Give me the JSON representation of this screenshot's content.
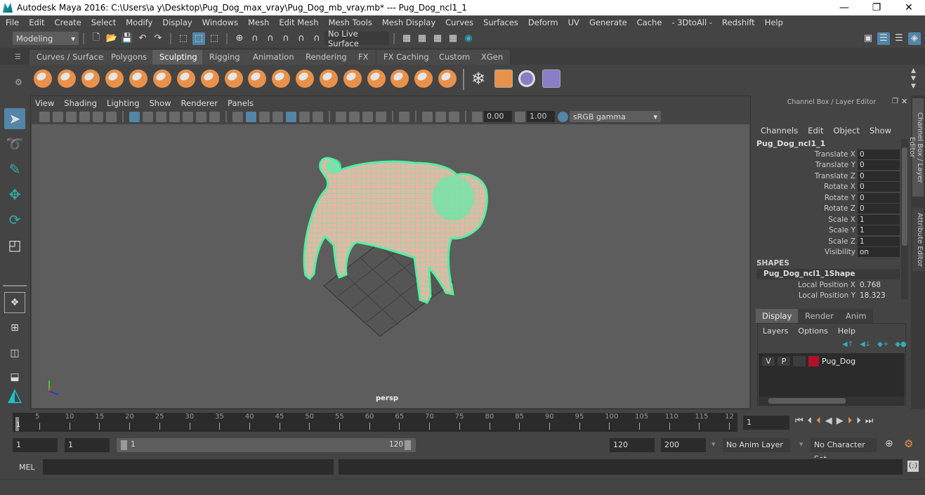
{
  "window": {
    "title": "Autodesk Maya 2016: C:\\Users\\a y\\Desktop\\Pug_Dog_max_vray\\Pug_Dog_mb_vray.mb*   ---   Pug_Dog_ncl1_1",
    "minimize": "—",
    "maximize": "❐",
    "close": "✕"
  },
  "menubar": [
    "File",
    "Edit",
    "Create",
    "Select",
    "Modify",
    "Display",
    "Windows",
    "Mesh",
    "Edit Mesh",
    "Mesh Tools",
    "Mesh Display",
    "Curves",
    "Surfaces",
    "Deform",
    "UV",
    "Generate",
    "Cache",
    "- 3DtoAll -",
    "Redshift",
    "Help"
  ],
  "statusline": {
    "menuset": "Modeling",
    "live_surface": "No Live Surface"
  },
  "shelf": {
    "tabs": [
      "Curves / Surfaces",
      "Polygons",
      "Sculpting",
      "Rigging",
      "Animation",
      "Rendering",
      "FX",
      "FX Caching",
      "Custom",
      "XGen"
    ],
    "active_tab": "Sculpting",
    "tools": [
      "sculpt",
      "smooth",
      "relax",
      "grab",
      "pinch",
      "flatten",
      "foamy",
      "spray",
      "repeat",
      "imprint",
      "wax",
      "scrape",
      "fill",
      "knife",
      "smear",
      "bulge",
      "amplify",
      "freeze",
      "convert-to-frozen",
      "mesh-settings",
      "texture-deformer",
      "blend-shape"
    ]
  },
  "viewport": {
    "menus": [
      "View",
      "Shading",
      "Lighting",
      "Show",
      "Renderer",
      "Panels"
    ],
    "exposure": "0.00",
    "gamma": "1.00",
    "color_space": "sRGB gamma",
    "camera_label": "persp",
    "wire_color": "#5af0a8"
  },
  "channel_box": {
    "title": "Channel Box / Layer Editor",
    "menus": [
      "Channels",
      "Edit",
      "Object",
      "Show"
    ],
    "object_name": "Pug_Dog_ncl1_1",
    "channels": [
      {
        "label": "Translate X",
        "value": "0"
      },
      {
        "label": "Translate Y",
        "value": "0"
      },
      {
        "label": "Translate Z",
        "value": "0"
      },
      {
        "label": "Rotate X",
        "value": "0"
      },
      {
        "label": "Rotate Y",
        "value": "0"
      },
      {
        "label": "Rotate Z",
        "value": "0"
      },
      {
        "label": "Scale X",
        "value": "1"
      },
      {
        "label": "Scale Y",
        "value": "1"
      },
      {
        "label": "Scale Z",
        "value": "1"
      },
      {
        "label": "Visibility",
        "value": "on"
      }
    ],
    "shapes_header": "SHAPES",
    "shape_name": "Pug_Dog_ncl1_1Shape",
    "shape_channels": [
      {
        "label": "Local Position X",
        "value": "0.768"
      },
      {
        "label": "Local Position Y",
        "value": "18.323"
      }
    ]
  },
  "side_tabs": [
    "Channel Box / Layer Editor",
    "Attribute Editor"
  ],
  "layer_editor": {
    "tabs": [
      "Display",
      "Render",
      "Anim"
    ],
    "active_tab": "Display",
    "menus": [
      "Layers",
      "Options",
      "Help"
    ],
    "layers": [
      {
        "visible": "V",
        "playback": "P",
        "name": "Pug_Dog",
        "color": "#b0102a"
      }
    ]
  },
  "timeline": {
    "ticks": [
      "5",
      "10",
      "15",
      "20",
      "25",
      "30",
      "35",
      "40",
      "45",
      "50",
      "55",
      "60",
      "65",
      "70",
      "75",
      "80",
      "85",
      "90",
      "95",
      "100",
      "105",
      "110",
      "115",
      "12"
    ],
    "current_frame_marker": "1",
    "current_frame": "1"
  },
  "range": {
    "start": "1",
    "playback_start": "1",
    "slider_start": "1",
    "slider_end": "120",
    "playback_end": "120",
    "end": "200",
    "anim_layer": "No Anim Layer",
    "character_set": "No Character Set"
  },
  "command_line": {
    "language": "MEL",
    "input": "",
    "output": ""
  }
}
